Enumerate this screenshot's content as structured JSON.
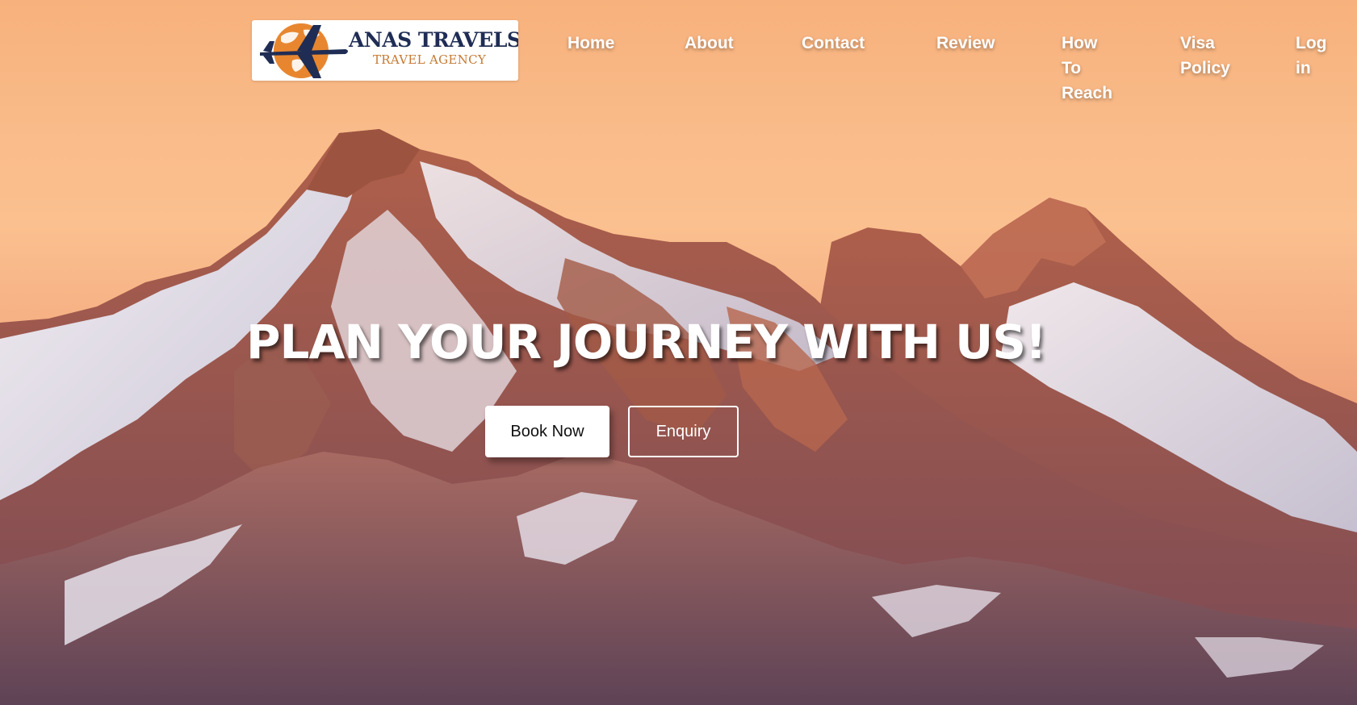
{
  "brand": {
    "title": "ANAS TRAVELS",
    "subtitle": "TRAVEL AGENCY"
  },
  "nav": {
    "home": "Home",
    "about": "About",
    "contact": "Contact",
    "review": "Review",
    "how_to_reach": "How To Reach",
    "visa_policy": "Visa Policy",
    "login": "Log in"
  },
  "hero": {
    "headline": "PLAN YOUR JOURNEY WITH US!",
    "book_label": "Book Now",
    "enquiry_label": "Enquiry"
  },
  "colors": {
    "sky_top": "#f7b17c",
    "logo_navy": "#1f2d55",
    "logo_orange": "#c67a33"
  }
}
